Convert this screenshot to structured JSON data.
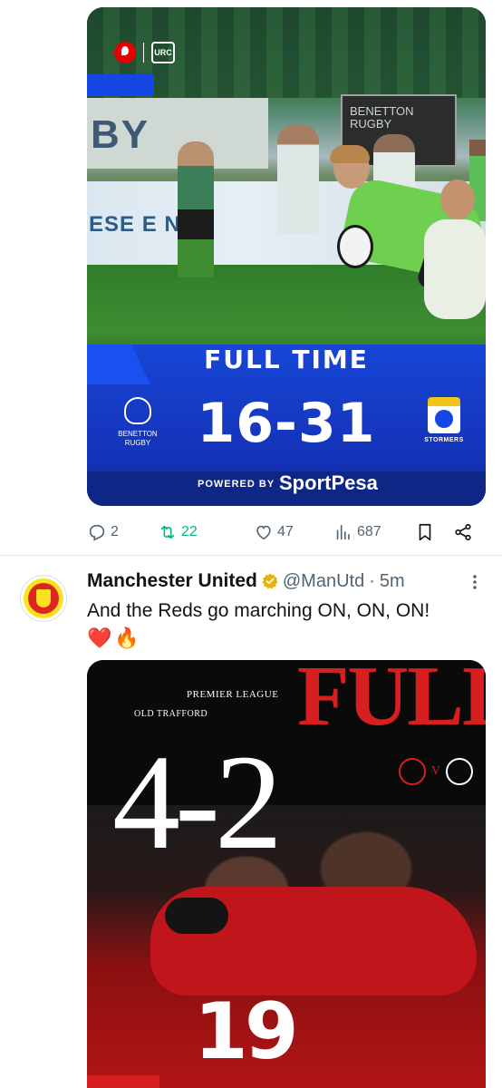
{
  "tweet1": {
    "media": {
      "headline": "FULL TIME",
      "score": "16-31",
      "home_team": "BENETTON RUGBY",
      "away_team": "STORMERS",
      "powered_by": "POWERED BY",
      "sponsor": "SportPesa",
      "board_left_text": "BY",
      "board_right_text": "BENETTON RUGBY",
      "adboard_text": "ESE E N",
      "league_logo_text": "URC"
    },
    "actions": {
      "replies": "2",
      "reposts": "22",
      "likes": "47",
      "views": "687"
    }
  },
  "tweet2": {
    "author_name": "Manchester United",
    "handle": "@ManUtd",
    "separator": "·",
    "time": "5m",
    "text": "And the Reds go marching ON, ON, ON!",
    "emojis": [
      "❤️",
      "🔥"
    ],
    "media": {
      "competition": "PREMIER LEAGUE",
      "venue": "OLD TRAFFORD",
      "headline": "FULL",
      "score": "4-2",
      "versus": "V",
      "shirt_number": "19"
    }
  },
  "colors": {
    "accent_blue": "#1447e6",
    "repost_green": "#00ba7c",
    "secondary_text": "#536471",
    "verified_gold": "#e8b10b",
    "united_red": "#d81f1f"
  },
  "icons": [
    "vodafone-logo",
    "reply-icon",
    "repost-icon",
    "like-icon",
    "views-icon",
    "bookmark-icon",
    "share-icon",
    "verified-badge-icon",
    "more-icon"
  ]
}
